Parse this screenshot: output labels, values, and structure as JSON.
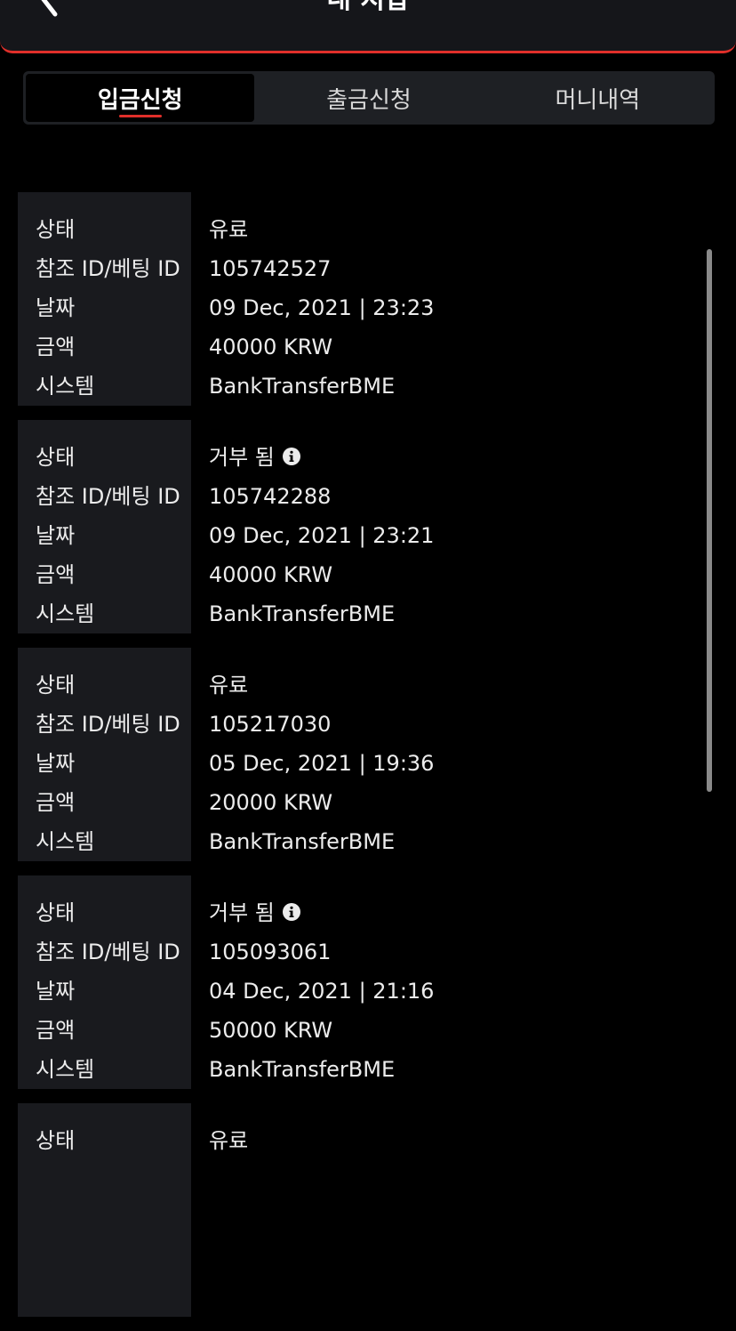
{
  "header": {
    "title": "내 지갑",
    "back_icon": "chevron-left-icon",
    "accent_color": "#e02f2a"
  },
  "tabs": [
    {
      "label": "입금신청",
      "active": true
    },
    {
      "label": "출금신청",
      "active": false
    },
    {
      "label": "머니내역",
      "active": false
    }
  ],
  "labels": {
    "status": "상태",
    "ref": "참조 ID/베팅 ID",
    "date": "날짜",
    "amount": "금액",
    "system": "시스템"
  },
  "transactions": [
    {
      "status": "유료",
      "ref": "105742527",
      "date": "09 Dec, 2021 | 23:23",
      "amount": "40000 KRW",
      "system": "BankTransferBME"
    },
    {
      "status": "거부 됨",
      "status_icon": "info-icon",
      "ref": "105742288",
      "date": "09 Dec, 2021 | 23:21",
      "amount": "40000 KRW",
      "system": "BankTransferBME"
    },
    {
      "status": "유료",
      "ref": "105217030",
      "date": "05 Dec, 2021 | 19:36",
      "amount": "20000 KRW",
      "system": "BankTransferBME"
    },
    {
      "status": "거부 됨",
      "status_icon": "info-icon",
      "ref": "105093061",
      "date": "04 Dec, 2021 | 21:16",
      "amount": "50000 KRW",
      "system": "BankTransferBME"
    },
    {
      "status": "유료"
    }
  ]
}
